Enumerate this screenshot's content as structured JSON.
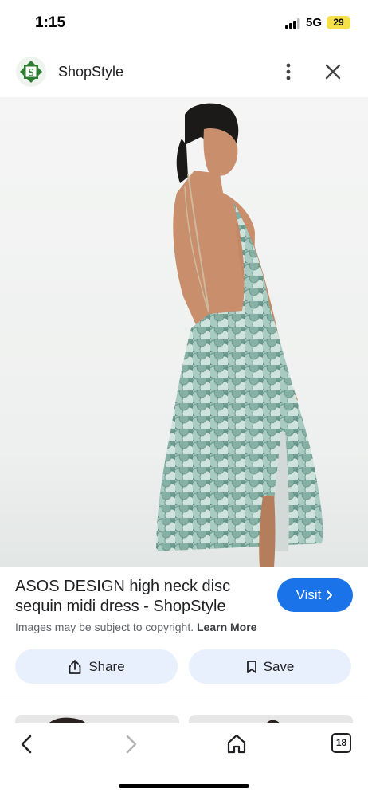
{
  "status_bar": {
    "time": "1:15",
    "network": "5G",
    "battery": "29"
  },
  "header": {
    "site_name": "ShopStyle",
    "logo_letter": "S"
  },
  "product": {
    "title": "ASOS DESIGN high neck disc sequin midi dress - ShopStyle",
    "visit_label": "Visit",
    "copyright_text": "Images may be subject to copyright.",
    "learn_more": "Learn More"
  },
  "actions": {
    "share_label": "Share",
    "save_label": "Save"
  },
  "toolbar": {
    "tab_count": "18"
  },
  "icons": [
    "signal-icon",
    "battery-icon",
    "shopstyle-logo",
    "more-vert-icon",
    "close-icon",
    "chevron-right-icon",
    "share-icon",
    "bookmark-icon",
    "back-arrow-icon",
    "forward-arrow-icon",
    "home-icon",
    "tabs-icon"
  ],
  "colors": {
    "accent": "#1a73e8",
    "action_bg": "#e8f0fe",
    "battery": "#f6e04a",
    "logo_green": "#2e7d32"
  }
}
